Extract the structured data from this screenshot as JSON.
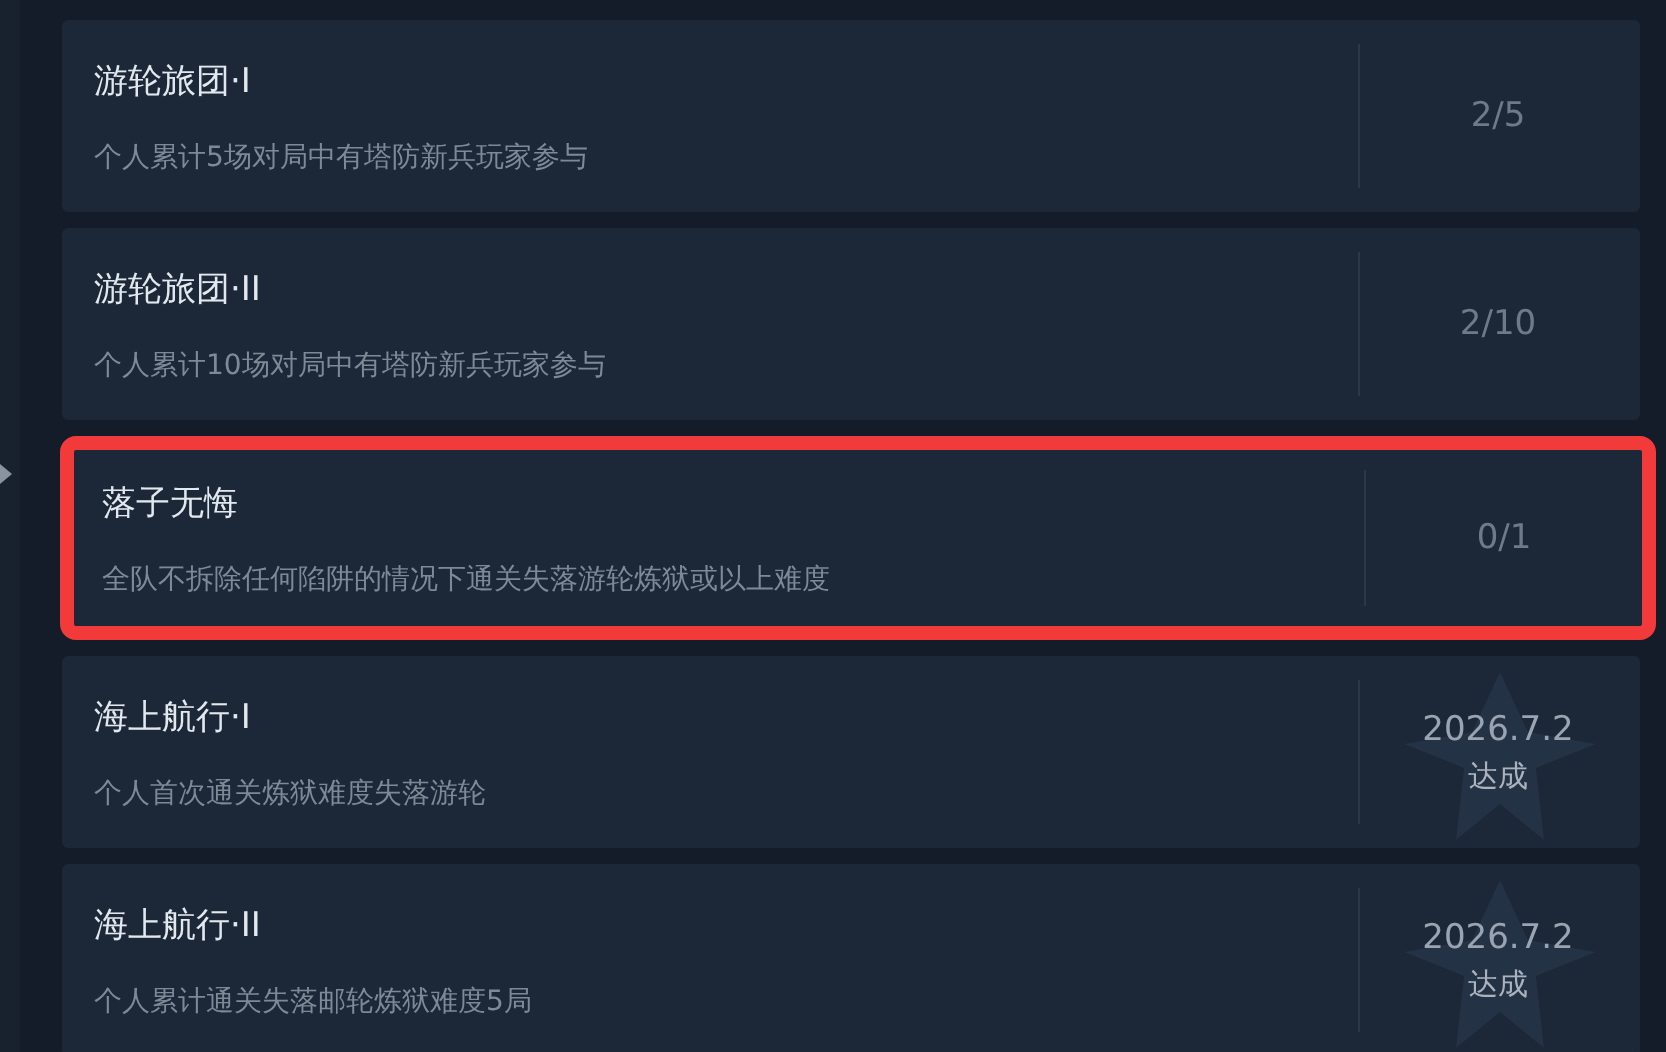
{
  "achievements": [
    {
      "title": "游轮旅团·I",
      "description": "个人累计5场对局中有塔防新兵玩家参与",
      "kind": "progress",
      "progress": "2/5",
      "highlighted": false
    },
    {
      "title": "游轮旅团·II",
      "description": "个人累计10场对局中有塔防新兵玩家参与",
      "kind": "progress",
      "progress": "2/10",
      "highlighted": false
    },
    {
      "title": "落子无悔",
      "description": "全队不拆除任何陷阱的情况下通关失落游轮炼狱或以上难度",
      "kind": "progress",
      "progress": "0/1",
      "highlighted": true
    },
    {
      "title": "海上航行·I",
      "description": "个人首次通关炼狱难度失落游轮",
      "kind": "completed",
      "date": "2026.7.2",
      "status": "达成",
      "highlighted": false
    },
    {
      "title": "海上航行·II",
      "description": "个人累计通关失落邮轮炼狱难度5局",
      "kind": "completed",
      "date": "2026.7.2",
      "status": "达成",
      "highlighted": false
    }
  ]
}
